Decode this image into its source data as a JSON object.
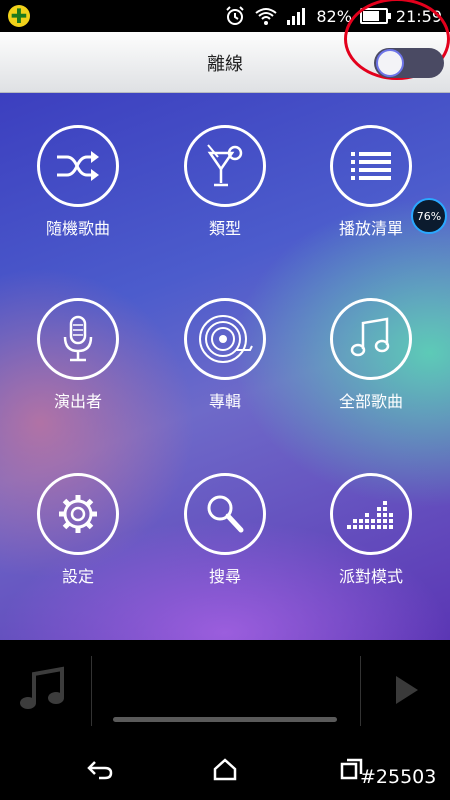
{
  "status_bar": {
    "battery_percent": "82%",
    "battery_level": 0.82,
    "time": "21:59",
    "icons": [
      "app-badge-icon",
      "alarm-icon",
      "wifi-icon",
      "signal-icon",
      "battery-icon"
    ]
  },
  "title_bar": {
    "title": "離線",
    "offline_toggle": {
      "on": false
    }
  },
  "menu": [
    {
      "label": "隨機歌曲",
      "icon": "shuffle-icon"
    },
    {
      "label": "類型",
      "icon": "cocktail-icon"
    },
    {
      "label": "播放清單",
      "icon": "playlist-icon"
    },
    {
      "label": "演出者",
      "icon": "microphone-icon"
    },
    {
      "label": "專輯",
      "icon": "vinyl-record-icon"
    },
    {
      "label": "全部歌曲",
      "icon": "music-note-icon"
    },
    {
      "label": "設定",
      "icon": "gear-icon"
    },
    {
      "label": "搜尋",
      "icon": "magnifier-icon"
    },
    {
      "label": "派對模式",
      "icon": "equalizer-icon"
    }
  ],
  "overlay_badge": {
    "text": "76%"
  },
  "player": {
    "progress": 0,
    "icons": [
      "music-note-icon",
      "play-icon"
    ]
  },
  "nav_bar": {
    "icons": [
      "back-icon",
      "home-icon",
      "recent-apps-icon"
    ]
  },
  "watermark": "#25503"
}
